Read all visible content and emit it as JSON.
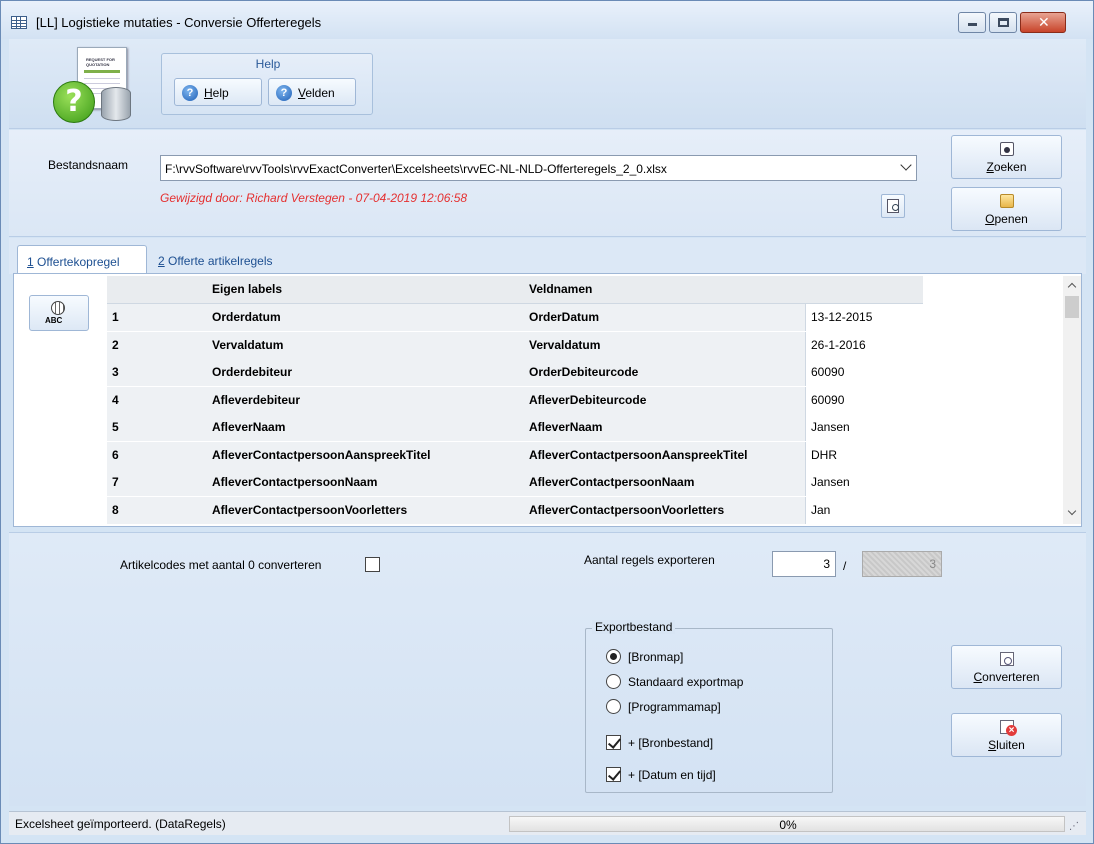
{
  "window": {
    "title": "[LL]  Logistieke mutaties - Conversie Offerteregels"
  },
  "logo": {
    "doc_text": "REQUEST FOR QUOTATION"
  },
  "help_group": {
    "caption": "Help",
    "help_label": "Help",
    "velden_label": "Velden"
  },
  "file": {
    "label": "Bestandsnaam",
    "path": "F:\\rvvSoftware\\rvvTools\\rvvExactConverter\\Excelsheets\\rvvEC-NL-NLD-Offerteregels_2_0.xlsx",
    "modified": "Gewijzigd door: Richard Verstegen   -   07-04-2019  12:06:58",
    "zoeken": "Zoeken",
    "openen": "Openen"
  },
  "tabs": [
    {
      "label": "1 Offertekopregel",
      "active": true
    },
    {
      "label": "2 Offerte artikelregels",
      "active": false
    }
  ],
  "abc_button": {
    "label": "ABC"
  },
  "grid": {
    "headers": [
      "",
      "Eigen labels",
      "Veldnamen",
      ""
    ],
    "rows": [
      {
        "nr": "1",
        "label": "Orderdatum",
        "field": "OrderDatum",
        "value": "13-12-2015"
      },
      {
        "nr": "2",
        "label": "Vervaldatum",
        "field": "Vervaldatum",
        "value": "26-1-2016"
      },
      {
        "nr": "3",
        "label": "Orderdebiteur",
        "field": "OrderDebiteurcode",
        "value": "60090"
      },
      {
        "nr": "4",
        "label": "Afleverdebiteur",
        "field": "AfleverDebiteurcode",
        "value": "60090"
      },
      {
        "nr": "5",
        "label": "AfleverNaam",
        "field": "AfleverNaam",
        "value": "Jansen"
      },
      {
        "nr": "6",
        "label": "AfleverContactpersoonAanspreekTitel",
        "field": "AfleverContactpersoonAanspreekTitel",
        "value": "DHR"
      },
      {
        "nr": "7",
        "label": "AfleverContactpersoonNaam",
        "field": "AfleverContactpersoonNaam",
        "value": "Jansen"
      },
      {
        "nr": "8",
        "label": "AfleverContactpersoonVoorletters",
        "field": "AfleverContactpersoonVoorletters",
        "value": "Jan"
      }
    ]
  },
  "options": {
    "artikelcodes_label": "Artikelcodes met aantal 0 converteren",
    "artikelcodes_checked": false,
    "aantal_label": "Aantal regels exporteren",
    "aantal_value": "3",
    "slash": "/",
    "aantal_total": "3"
  },
  "export": {
    "caption": "Exportbestand",
    "radios": [
      {
        "label": "[Bronmap]",
        "checked": true
      },
      {
        "label": "Standaard exportmap",
        "checked": false
      },
      {
        "label": "[Programmamap]",
        "checked": false
      }
    ],
    "checks": [
      {
        "label": "+ [Bronbestand]",
        "checked": true
      },
      {
        "label": "+ [Datum en tijd]",
        "checked": true
      }
    ]
  },
  "actions": {
    "converteren": "Converteren",
    "sluiten": "Sluiten"
  },
  "status": {
    "text": "Excelsheet geïmporteerd. (DataRegels)",
    "progress": "0%"
  }
}
